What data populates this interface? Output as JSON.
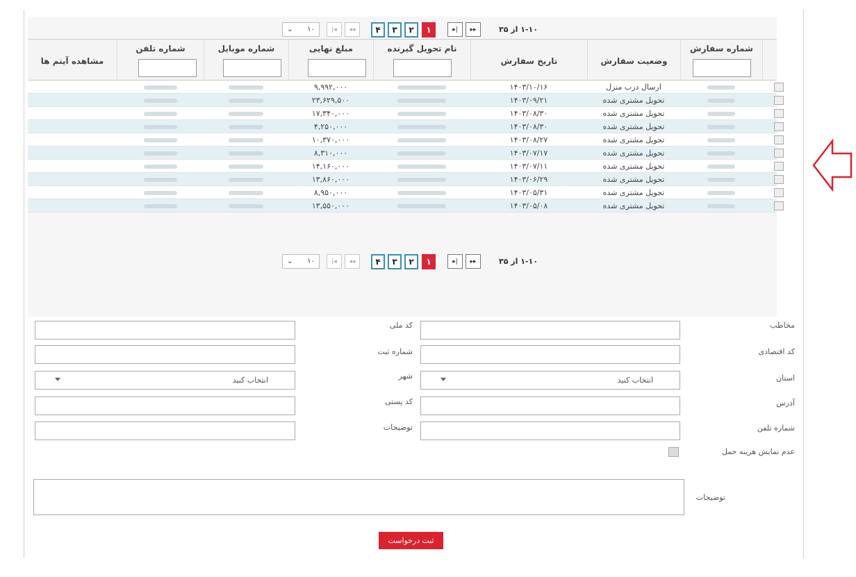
{
  "pager": {
    "page_size": "۱۰",
    "range_text": "۱-۱۰ از ۳۵",
    "pages": [
      "۴",
      "۳",
      "۲",
      "۱"
    ],
    "current_page": "۱",
    "first_icon": "first-page-icon",
    "prev_icon": "prev-page-icon",
    "next_icon": "next-page-icon",
    "last_icon": "last-page-icon"
  },
  "table": {
    "headers": {
      "order_number": "شماره سفارش",
      "order_status": "وضعیت سفارش",
      "order_date": "تاریخ سفارش",
      "recipient_name": "نام تحویل گیرنده",
      "final_amount": "مبلغ نهایی",
      "mobile": "شماره موبایل",
      "phone": "شماره تلفن",
      "view_items": "مشاهده آیتم ها"
    },
    "rows": [
      {
        "status": "ارسال درب منزل",
        "date": "۱۴۰۳/۱۰/۱۶",
        "amount": "۹,۹۹۲,۰۰۰"
      },
      {
        "status": "تحویل مشتری شده",
        "date": "۱۴۰۳/۰۹/۲۱",
        "amount": "۲۳,۶۲۹,۵۰۰"
      },
      {
        "status": "تحویل مشتری شده",
        "date": "۱۴۰۳/۰۸/۳۰",
        "amount": "۱۷,۳۴۰,۰۰۰"
      },
      {
        "status": "تحویل مشتری شده",
        "date": "۱۴۰۳/۰۸/۳۰",
        "amount": "۴,۲۵۰,۰۰۰"
      },
      {
        "status": "تحویل مشتری شده",
        "date": "۱۴۰۳/۰۸/۲۷",
        "amount": "۱۰,۳۷۰,۰۰۰"
      },
      {
        "status": "تحویل مشتری شده",
        "date": "۱۴۰۳/۰۷/۱۷",
        "amount": "۸,۳۱۰,۰۰۰"
      },
      {
        "status": "تحویل مشتری شده",
        "date": "۱۴۰۳/۰۷/۱۱",
        "amount": "۱۴,۱۶۰,۰۰۰"
      },
      {
        "status": "تحویل مشتری شده",
        "date": "۱۴۰۳/۰۶/۲۹",
        "amount": "۱۳,۸۶۰,۰۰۰"
      },
      {
        "status": "تحویل مشتری شده",
        "date": "۱۴۰۳/۰۵/۳۱",
        "amount": "۸,۹۵۰,۰۰۰"
      },
      {
        "status": "تحویل مشتری شده",
        "date": "۱۴۰۳/۰۵/۰۸",
        "amount": "۱۳,۵۵۰,۰۰۰"
      }
    ]
  },
  "form": {
    "contact_label": "مخاطب",
    "national_id_label": "کد ملی",
    "economic_code_label": "کد اقتصادی",
    "registration_number_label": "شماره ثبت",
    "province_label": "استان",
    "province_value": "انتخاب کنید",
    "city_label": "شهر",
    "city_value": "انتخاب کنید",
    "address_label": "آدرس",
    "postal_code_label": "کد پستی",
    "phone_label": "شماره تلفن",
    "notes_label": "توضیحات",
    "hide_shipping_label": "عدم نمایش هزینه حمل",
    "description_label": "توضیحات",
    "submit_label": "ثبت درخواست"
  },
  "colors": {
    "accent_red": "#d9232f",
    "page_border": "#3a8fb5",
    "row_alt": "#e4f1f4",
    "arrow": "#d9232f"
  }
}
